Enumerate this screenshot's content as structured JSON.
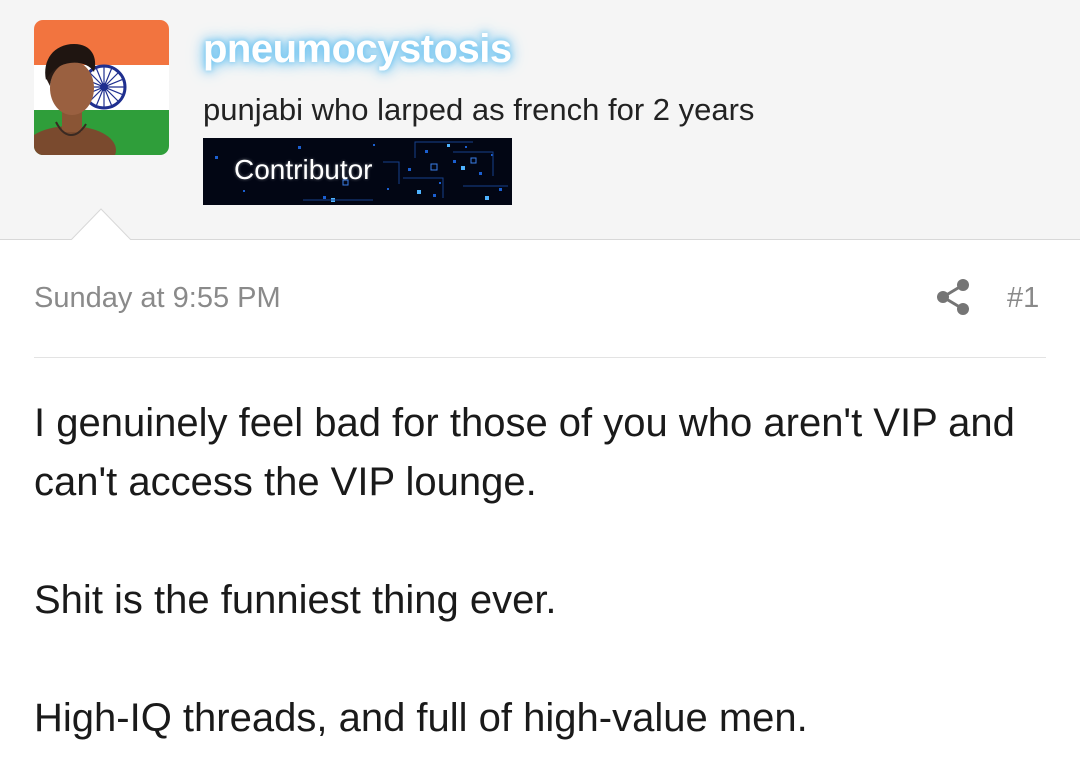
{
  "user": {
    "username": "pneumocystosis",
    "user_title": "punjabi who larped as french for 2 years",
    "banner": "Contributor",
    "avatar_icon": "india-flag-avatar-icon"
  },
  "post": {
    "date": "Sunday at 9:55 PM",
    "share_icon": "share-icon",
    "number": "#1",
    "paragraphs": [
      "I genuinely feel bad for those of you who aren't VIP and can't access the VIP lounge.",
      "Shit is the funniest thing ever.",
      "High-IQ threads, and full of high-value men."
    ]
  },
  "colors": {
    "header_bg": "#f5f5f5",
    "username_glow": "#6fc6f2",
    "meta_text": "#8a8a8a",
    "body_text": "#1a1a1a",
    "banner_bg": "#020614"
  }
}
